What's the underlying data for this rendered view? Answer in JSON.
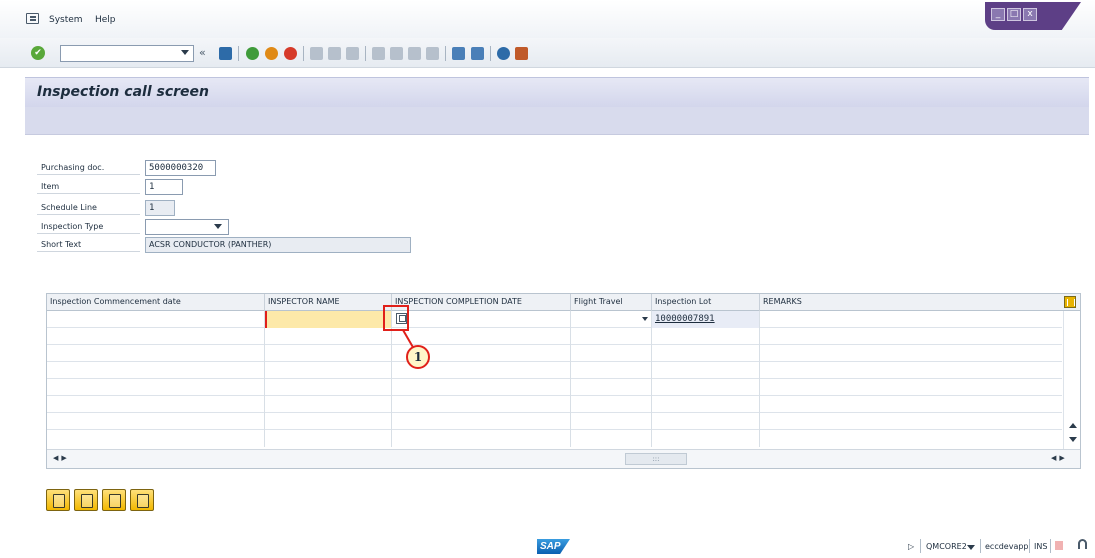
{
  "menu": {
    "items": [
      {
        "label": "System",
        "u": "S"
      },
      {
        "label": "Help",
        "u": "H"
      }
    ]
  },
  "window_controls": {
    "minimize": "_",
    "maximize": "□",
    "close": "x"
  },
  "toolbar": {
    "command_field_value": "",
    "chevron": "«"
  },
  "title": "Inspection call screen",
  "form": {
    "purchasing_doc": {
      "label": "Purchasing doc.",
      "value": "5000000320"
    },
    "item": {
      "label": "Item",
      "value": "1"
    },
    "schedule_line": {
      "label": "Schedule Line",
      "value": "1"
    },
    "inspection_type": {
      "label": "Inspection Type",
      "value": ""
    },
    "short_text": {
      "label": "Short Text",
      "value": "ACSR CONDUCTOR (PANTHER)"
    }
  },
  "table": {
    "columns": [
      "Inspection Commencement date",
      "INSPECTOR NAME",
      "INSPECTION COMPLETION DATE",
      "Flight Travel",
      "Inspection Lot",
      "REMARKS"
    ],
    "rows": [
      {
        "commencement": "",
        "inspector": "",
        "completion": "",
        "flight": "",
        "lot": "10000007891",
        "remarks": ""
      }
    ],
    "empty_rows": 7,
    "hscroll_thumb": ":::"
  },
  "callout": {
    "number": "1"
  },
  "status": {
    "play": "▷",
    "system": "QMCORE2",
    "server": "eccdevapp",
    "mode": "INS",
    "sap_logo": "SAP"
  }
}
